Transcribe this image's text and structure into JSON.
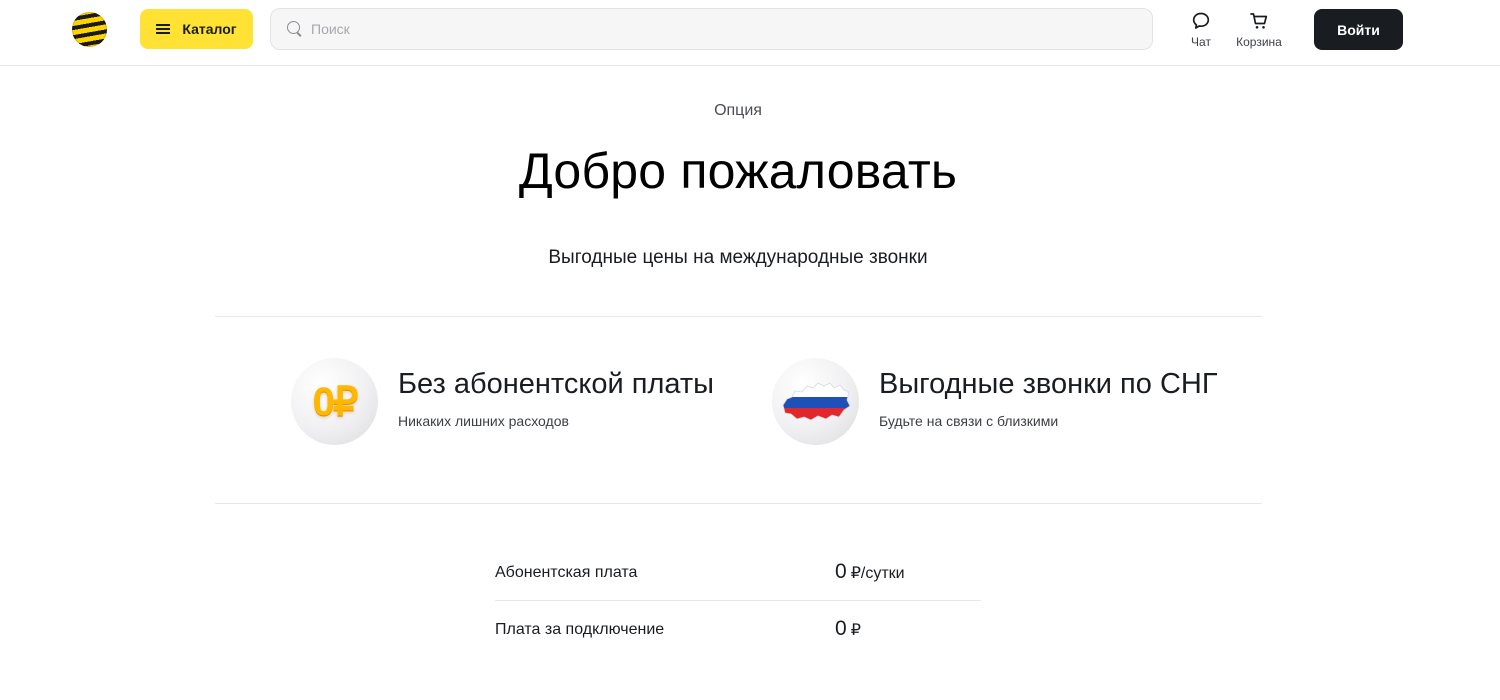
{
  "header": {
    "logo_icon": "beeline-logo-icon",
    "catalog_label": "Каталог",
    "search_placeholder": "Поиск",
    "chat_label": "Чат",
    "cart_label": "Корзина",
    "login_label": "Войти"
  },
  "hero": {
    "eyebrow": "Опция",
    "title": "Добро пожаловать",
    "subtitle": "Выгодные цены на международные звонки"
  },
  "features": [
    {
      "icon": "zero-ruble-coin-icon",
      "icon_text": "0₽",
      "title": "Без абонентской платы",
      "description": "Никаких лишних расходов"
    },
    {
      "icon": "russia-map-flag-icon",
      "title": "Выгодные звонки по СНГ",
      "description": "Будьте на связи с близкими"
    }
  ],
  "prices": [
    {
      "label": "Абонентская плата",
      "amount": "0",
      "unit": "₽/сутки"
    },
    {
      "label": "Плата за подключение",
      "amount": "0",
      "unit": "₽"
    }
  ],
  "colors": {
    "accent_yellow": "#ffe234",
    "dark": "#191c20",
    "divider": "#e6e7ea"
  }
}
